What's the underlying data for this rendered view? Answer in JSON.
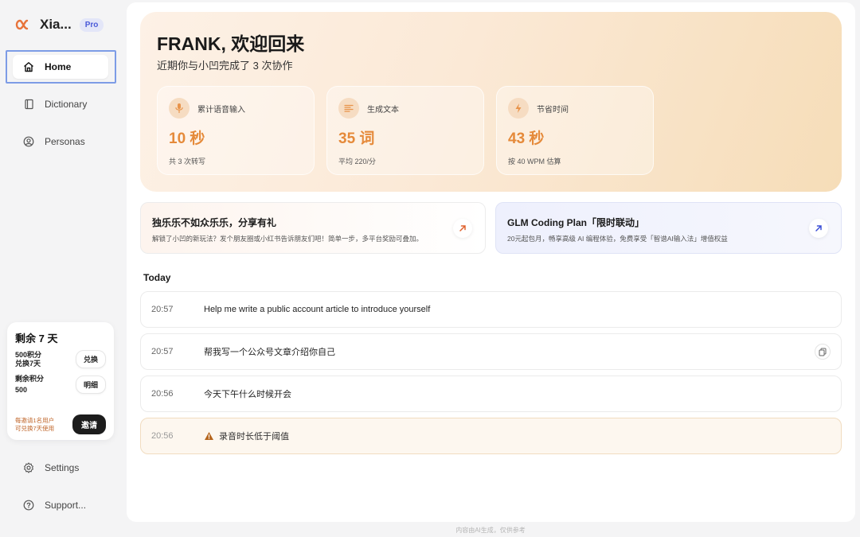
{
  "brand": {
    "name": "Xia...",
    "badge": "Pro"
  },
  "nav": {
    "home": "Home",
    "dictionary": "Dictionary",
    "personas": "Personas",
    "settings": "Settings",
    "support": "Support..."
  },
  "promo": {
    "title": "剩余 7 天",
    "redeem_label_1": "500积分",
    "redeem_label_2": "兑换7天",
    "redeem_button": "兑换",
    "balance_label_1": "剩余积分",
    "balance_label_2": "500",
    "detail_button": "明细",
    "invite_note_1": "每邀请1名用户",
    "invite_note_2": "可兑换7天使用",
    "invite_button": "邀请"
  },
  "hero": {
    "title": "FRANK, 欢迎回来",
    "subtitle": "近期你与小凹完成了 3 次协作",
    "stats": [
      {
        "icon": "microphone-icon",
        "label": "累计语音输入",
        "value": "10 秒",
        "note": "共 3 次转写"
      },
      {
        "icon": "text-lines-icon",
        "label": "生成文本",
        "value": "35 词",
        "note": "平均 220/分"
      },
      {
        "icon": "lightning-icon",
        "label": "节省时间",
        "value": "43 秒",
        "note": "按 40 WPM 估算"
      }
    ]
  },
  "banners": [
    {
      "title": "独乐乐不如众乐乐，分享有礼",
      "desc": "解锁了小凹的新玩法？发个朋友圈或小红书告诉朋友们吧！简单一步，多平台奖励可叠加。",
      "arrow_color": "#e0622e"
    },
    {
      "title": "GLM Coding Plan「限时联动」",
      "desc": "20元起包月，畅享高级 AI 编程体验，免费享受「智谱AI输入法」增值权益",
      "arrow_color": "#3b4ed6"
    }
  ],
  "history": {
    "section_label": "Today",
    "items": [
      {
        "time": "20:57",
        "text": "Help me write a public account article to introduce yourself"
      },
      {
        "time": "20:57",
        "text": "帮我写一个公众号文章介绍你自己"
      },
      {
        "time": "20:56",
        "text": "今天下午什么时候开会"
      },
      {
        "time": "20:56",
        "text": "录音时长低于阈值"
      }
    ]
  },
  "footer": {
    "note": "内容由AI生成，仅供参考"
  },
  "colors": {
    "accent_orange": "#e58a3a",
    "badge_blue": "#4a5ad8",
    "warning": "#b5651d"
  }
}
